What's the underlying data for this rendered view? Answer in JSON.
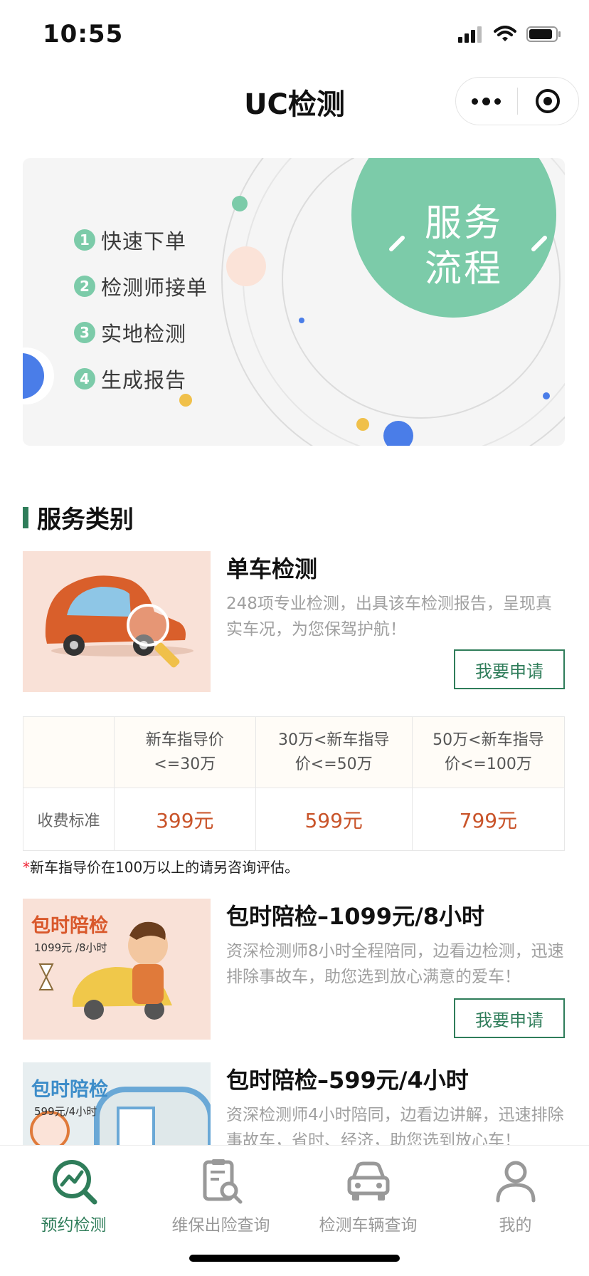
{
  "status": {
    "time": "10:55"
  },
  "nav": {
    "title": "UC检测"
  },
  "banner": {
    "steps": [
      {
        "num": "1",
        "label": "快速下单"
      },
      {
        "num": "2",
        "label": "检测师接单"
      },
      {
        "num": "3",
        "label": "实地检测"
      },
      {
        "num": "4",
        "label": "生成报告"
      }
    ],
    "badge": "服务流程"
  },
  "section": {
    "title": "服务类别"
  },
  "products": [
    {
      "title": "单车检测",
      "desc": "248项专业检测，出具该车检测报告，呈现真实车况，为您保驾护航！",
      "apply_label": "我要申请"
    },
    {
      "title": "包时陪检–1099元/8小时",
      "desc": "资深检测师8小时全程陪同，边看边检测，迅速排除事故车，助您选到放心满意的爱车！",
      "apply_label": "我要申请",
      "image_title": "包时陪检",
      "image_sub": "1099元 /8小时"
    },
    {
      "title": "包时陪检–599元/4小时",
      "desc": "资深检测师4小时陪同，边看边讲解，迅速排除事故车，省时、经济，助您选到放心车！",
      "image_title": "包时陪检",
      "image_sub": "599元/4小时"
    }
  ],
  "price_table": {
    "headers": [
      "新车指导价<=30万",
      "30万<新车指导价<=50万",
      "50万<新车指导价<=100万"
    ],
    "row_label": "收费标准",
    "prices": [
      "399元",
      "599元",
      "799元"
    ]
  },
  "note": {
    "star": "*",
    "text": "新车指导价在100万以上的请另咨询评估。"
  },
  "tabs": [
    {
      "label": "预约检测",
      "icon": "chart-search-icon",
      "active": true
    },
    {
      "label": "维保出险查询",
      "icon": "document-search-icon",
      "active": false
    },
    {
      "label": "检测车辆查询",
      "icon": "car-icon",
      "active": false
    },
    {
      "label": "我的",
      "icon": "person-icon",
      "active": false
    }
  ],
  "colors": {
    "accent": "#2f7d5a",
    "mint": "#7ccba9",
    "price": "#c9542a",
    "blue": "#4a7de8",
    "yellow": "#f0c04a"
  }
}
